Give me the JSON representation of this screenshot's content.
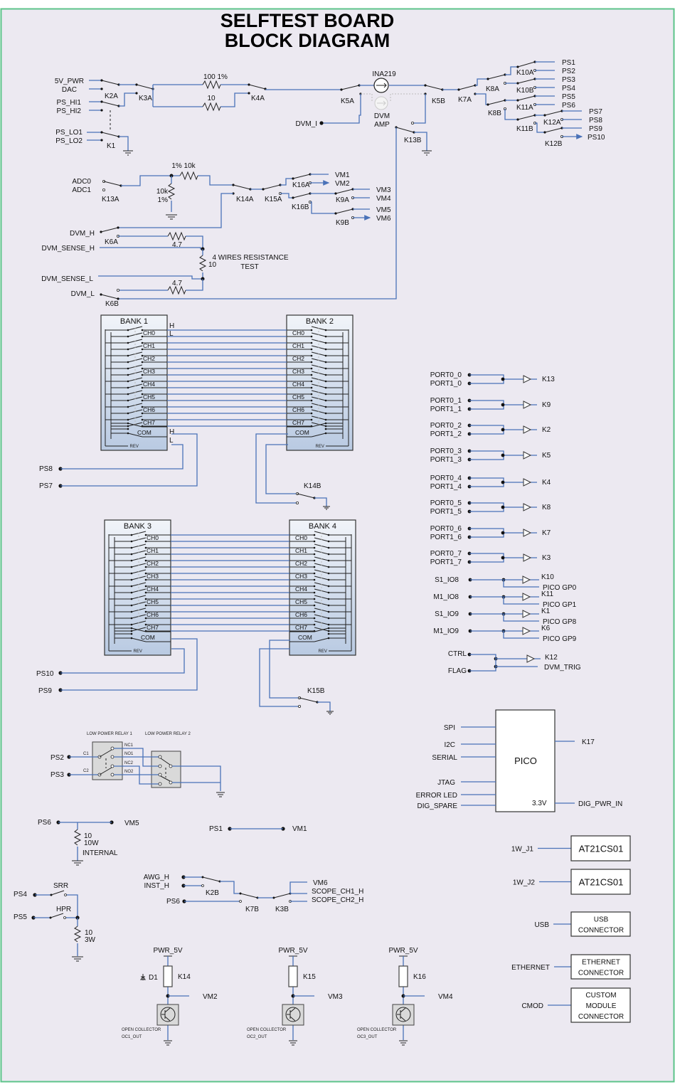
{
  "title": {
    "line1": "SELFTEST BOARD",
    "line2": "BLOCK DIAGRAM"
  },
  "colors": {
    "background": "#ece9f1",
    "frame": "#5cc48a",
    "wire": "#4a72b8",
    "bank_fill": "#c5d3e6"
  },
  "power_path": {
    "inputs": [
      "5V_PWR",
      "DAC",
      "PS_HI1",
      "PS_HI2",
      "PS_LO1",
      "PS_LO2"
    ],
    "relays": [
      "K2A",
      "K3A",
      "K4A",
      "K1",
      "K5A",
      "K5B",
      "K7A",
      "K8A",
      "K8B",
      "K10A",
      "K10B",
      "K11A",
      "K11B",
      "K12A",
      "K12B",
      "K13B"
    ],
    "resistor_100": "100 1%",
    "resistor_10": "10",
    "sensor": "INA219",
    "dvm_amp": "DVM AMP",
    "dvm_amp_l1": "DVM",
    "dvm_amp_l2": "AMP",
    "dvm_i": "DVM_I",
    "outputs": [
      "PS1",
      "PS2",
      "PS3",
      "PS4",
      "PS5",
      "PS6",
      "PS7",
      "PS8",
      "PS9",
      "PS10"
    ]
  },
  "measure": {
    "adc": [
      "ADC0",
      "ADC1"
    ],
    "k13a": "K13A",
    "r_top": "1% 10k",
    "r_shunt_1": "10k",
    "r_shunt_2": "1%",
    "relays": [
      "K14A",
      "K15A",
      "K16A",
      "K16B",
      "K9A",
      "K9B",
      "K6A",
      "K6B"
    ],
    "vm_outputs": [
      "VM1",
      "VM2",
      "VM3",
      "VM4",
      "VM5",
      "VM6"
    ],
    "dvm": [
      "DVM_H",
      "DVM_SENSE_H",
      "DVM_SENSE_L",
      "DVM_L"
    ],
    "r47": "4.7",
    "r10": "10",
    "four_wire_1": "4 WIRES RESISTANCE",
    "four_wire_2": "TEST"
  },
  "banks": {
    "bank1": "BANK 1",
    "bank2": "BANK 2",
    "bank3": "BANK 3",
    "bank4": "BANK 4",
    "channels": [
      "CH0",
      "CH1",
      "CH2",
      "CH3",
      "CH4",
      "CH5",
      "CH6",
      "CH7"
    ],
    "com": "COM",
    "rev": "REV",
    "h": "H",
    "l": "L",
    "ps8": "PS8",
    "ps7": "PS7",
    "ps10": "PS10",
    "ps9": "PS9",
    "k14b": "K14B",
    "k15b": "K15B"
  },
  "ports": [
    {
      "a": "PORT0_0",
      "b": "PORT1_0",
      "relay": "K13"
    },
    {
      "a": "PORT0_1",
      "b": "PORT1_1",
      "relay": "K9"
    },
    {
      "a": "PORT0_2",
      "b": "PORT1_2",
      "relay": "K2"
    },
    {
      "a": "PORT0_3",
      "b": "PORT1_3",
      "relay": "K5"
    },
    {
      "a": "PORT0_4",
      "b": "PORT1_4",
      "relay": "K4"
    },
    {
      "a": "PORT0_5",
      "b": "PORT1_5",
      "relay": "K8"
    },
    {
      "a": "PORT0_6",
      "b": "PORT1_6",
      "relay": "K7"
    },
    {
      "a": "PORT0_7",
      "b": "PORT1_7",
      "relay": "K3"
    }
  ],
  "io": [
    {
      "name": "S1_IO8",
      "relay": "K10",
      "gp": "PICO GP0"
    },
    {
      "name": "M1_IO8",
      "relay": "K11",
      "gp": "PICO GP1"
    },
    {
      "name": "S1_IO9",
      "relay": "K1",
      "gp": "PICO GP8"
    },
    {
      "name": "M1_IO9",
      "relay": "K6",
      "gp": "PICO GP9"
    }
  ],
  "ctrl": {
    "ctrl": "CTRL",
    "flag": "FLAG",
    "relay": "K12",
    "trig": "DVM_TRIG"
  },
  "pico": {
    "label": "PICO",
    "left": [
      "SPI",
      "I2C",
      "SERIAL",
      "JTAG",
      "ERROR LED",
      "DIG_SPARE"
    ],
    "k17": "K17",
    "v33": "3.3V",
    "dig_pwr": "DIG_PWR_IN"
  },
  "peripherals": [
    {
      "signal": "1W_J1",
      "lines": [
        "AT21CS01"
      ]
    },
    {
      "signal": "1W_J2",
      "lines": [
        "AT21CS01"
      ]
    },
    {
      "signal": "USB",
      "lines": [
        "USB",
        "CONNECTOR"
      ]
    },
    {
      "signal": "ETHERNET",
      "lines": [
        "ETHERNET",
        "CONNECTOR"
      ]
    },
    {
      "signal": "CMOD",
      "lines": [
        "CUSTOM",
        "MODULE",
        "CONNECTOR"
      ]
    }
  ],
  "low_power": {
    "relay1": "LOW POWER RELAY 1",
    "relay2": "LOW POWER RELAY 2",
    "ps2": "PS2",
    "ps3": "PS3",
    "c1": "C1",
    "c2": "C2",
    "nc1": "NC1",
    "no1": "NO1",
    "nc2": "NC2",
    "no2": "NO2"
  },
  "loads": {
    "ps6": "PS6",
    "vm5": "VM5",
    "r_val": "10",
    "r_pwr": "10W",
    "internal": "INTERNAL",
    "ps1": "PS1",
    "vm1": "VM1",
    "ps4": "PS4",
    "ps5": "PS5",
    "srr": "SRR",
    "hpr": "HPR",
    "r2_val": "10",
    "r2_pwr": "3W"
  },
  "scope": {
    "awg": "AWG_H",
    "inst": "INST_H",
    "ps6": "PS6",
    "k2b": "K2B",
    "k7b": "K7B",
    "k3b": "K3B",
    "vm6": "VM6",
    "ch1": "SCOPE_CH1_H",
    "ch2": "SCOPE_CH2_H"
  },
  "open_collectors": [
    {
      "pwr": "PWR_5V",
      "relay": "K14",
      "vm": "VM2",
      "l1": "OPEN COLLECTOR",
      "l2": "OC1_OUT",
      "diode": "D1"
    },
    {
      "pwr": "PWR_5V",
      "relay": "K15",
      "vm": "VM3",
      "l1": "OPEN COLLECTOR",
      "l2": "OC2_OUT"
    },
    {
      "pwr": "PWR_5V",
      "relay": "K16",
      "vm": "VM4",
      "l1": "OPEN COLLECTOR",
      "l2": "OC3_OUT"
    }
  ]
}
